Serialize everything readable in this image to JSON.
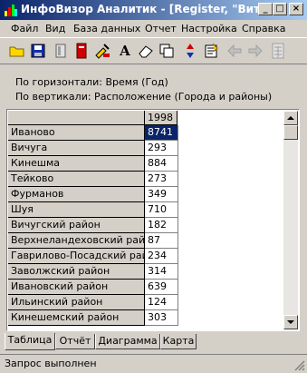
{
  "window": {
    "title": "ИнфоВизор Аналитик - [Register, \"Витри...",
    "min_glyph": "_",
    "max_glyph": "□",
    "close_glyph": "×"
  },
  "menu": [
    "Файл",
    "Вид",
    "База данных",
    "Отчет",
    "Настройка",
    "Справка"
  ],
  "toolbar": {
    "icons": [
      "open-folder-icon",
      "save-disk-icon",
      "document-icon",
      "red-book-icon",
      "paint-tools-icon",
      "font-a-icon",
      "eraser-icon",
      "copy-frames-icon",
      "sort-arrows-icon",
      "report-icon",
      "back-arrow-icon",
      "forward-arrow-icon",
      "calculator-icon"
    ],
    "font_letter": "A"
  },
  "info": {
    "horizontal": "По горизонтали: Время (Год)",
    "vertical": "По вертикали: Расположение (Города и районы)"
  },
  "grid": {
    "column_header": "1998",
    "rows": [
      {
        "name": "Иваново",
        "value": "8741"
      },
      {
        "name": "Вичуга",
        "value": "293"
      },
      {
        "name": "Кинешма",
        "value": "884"
      },
      {
        "name": "Тейково",
        "value": "273"
      },
      {
        "name": "Фурманов",
        "value": "349"
      },
      {
        "name": "Шуя",
        "value": "710"
      },
      {
        "name": "Вичугский район",
        "value": "182"
      },
      {
        "name": "Верхнеландеховский район",
        "value": "87"
      },
      {
        "name": "Гаврилово-Посадский район",
        "value": "234"
      },
      {
        "name": "Заволжский район",
        "value": "314"
      },
      {
        "name": "Ивановский район",
        "value": "639"
      },
      {
        "name": "Ильинский район",
        "value": "124"
      },
      {
        "name": "Кинешемский район",
        "value": "303"
      }
    ],
    "selected_row": 0
  },
  "tabs": [
    "Таблица",
    "Отчёт",
    "Диаграмма",
    "Карта"
  ],
  "active_tab": 0,
  "status": "Запрос выполнен",
  "colors": {
    "titlebar_start": "#0a246a",
    "titlebar_end": "#a6caf0",
    "selection": "#0a246a",
    "face": "#d4d0c8"
  }
}
